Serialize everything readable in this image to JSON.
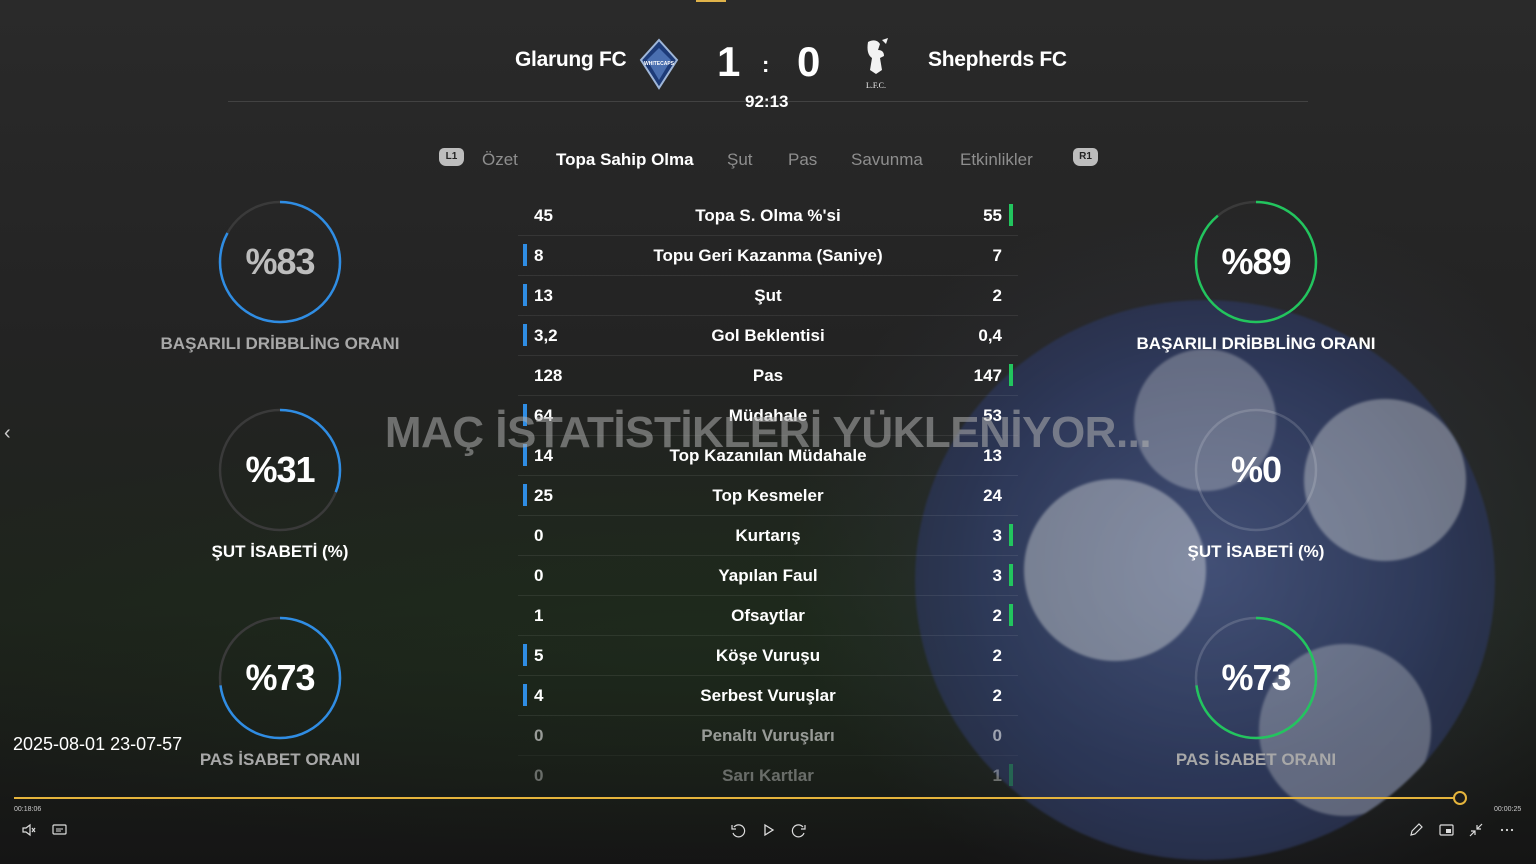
{
  "match": {
    "home_team": "Glarung FC",
    "away_team": "Shepherds FC",
    "home_score": "1",
    "away_score": "0",
    "separator": ":",
    "clock": "92:13",
    "home_crest_text": "WHITECAPS",
    "away_crest_text": "L.F.C."
  },
  "tabs": {
    "left_bumper": "L1",
    "right_bumper": "R1",
    "items": [
      {
        "label": "Özet",
        "active": false
      },
      {
        "label": "Topa Sahip Olma",
        "active": true
      },
      {
        "label": "Şut",
        "active": false
      },
      {
        "label": "Pas",
        "active": false
      },
      {
        "label": "Savunma",
        "active": false
      },
      {
        "label": "Etkinlikler",
        "active": false
      }
    ]
  },
  "left_rings": [
    {
      "value": "%83",
      "label": "BAŞARILI DRİBBLİNG ORANI",
      "fraction": 0.83
    },
    {
      "value": "%31",
      "label": "ŞUT İSABETİ (%)",
      "fraction": 0.31
    },
    {
      "value": "%73",
      "label": "PAS İSABET ORANI",
      "fraction": 0.73
    }
  ],
  "right_rings": [
    {
      "value": "%89",
      "label": "BAŞARILI DRİBBLİNG ORANI",
      "fraction": 0.89
    },
    {
      "value": "%0",
      "label": "ŞUT İSABETİ (%)",
      "fraction": 0.0
    },
    {
      "value": "%73",
      "label": "PAS İSABET ORANI",
      "fraction": 0.73
    }
  ],
  "stats": [
    {
      "left": "45",
      "label": "Topa S. Olma %'si",
      "right": "55",
      "lead": "right"
    },
    {
      "left": "8",
      "label": "Topu Geri Kazanma (Saniye)",
      "right": "7",
      "lead": "left"
    },
    {
      "left": "13",
      "label": "Şut",
      "right": "2",
      "lead": "left"
    },
    {
      "left": "3,2",
      "label": "Gol Beklentisi",
      "right": "0,4",
      "lead": "left"
    },
    {
      "left": "128",
      "label": "Pas",
      "right": "147",
      "lead": "right"
    },
    {
      "left": "64",
      "label": "Müdahale",
      "right": "53",
      "lead": "left"
    },
    {
      "left": "14",
      "label": "Top Kazanılan Müdahale",
      "right": "13",
      "lead": "left"
    },
    {
      "left": "25",
      "label": "Top Kesmeler",
      "right": "24",
      "lead": "left"
    },
    {
      "left": "0",
      "label": "Kurtarış",
      "right": "3",
      "lead": "right"
    },
    {
      "left": "0",
      "label": "Yapılan Faul",
      "right": "3",
      "lead": "right"
    },
    {
      "left": "1",
      "label": "Ofsaytlar",
      "right": "2",
      "lead": "right"
    },
    {
      "left": "5",
      "label": "Köşe Vuruşu",
      "right": "2",
      "lead": "left"
    },
    {
      "left": "4",
      "label": "Serbest Vuruşlar",
      "right": "2",
      "lead": "left"
    },
    {
      "left": "0",
      "label": "Penaltı Vuruşları",
      "right": "0",
      "lead": "none"
    },
    {
      "left": "0",
      "label": "Sarı Kartlar",
      "right": "1",
      "lead": "right"
    }
  ],
  "overlay": {
    "loading_text": "MAÇ İSTATİSTİKLERİ YÜKLENİYOR..."
  },
  "player": {
    "timestamp": "2025-08-01 23-07-57",
    "elapsed": "00:18:06",
    "remaining": "00:00:25",
    "progress": 0.983
  },
  "colors": {
    "home_accent": "#2f8de4",
    "away_accent": "#22c55e",
    "progress_accent": "#e5b43c"
  },
  "icons": {
    "mute": "mute-icon",
    "captions": "captions-icon",
    "rewind": "rewind-10-icon",
    "play": "play-icon",
    "forward": "forward-30-icon",
    "edit": "pencil-icon",
    "miniplayer": "miniplayer-icon",
    "exit_fullscreen": "exit-fullscreen-icon",
    "more": "more-icon",
    "prev": "chevron-left-icon"
  }
}
